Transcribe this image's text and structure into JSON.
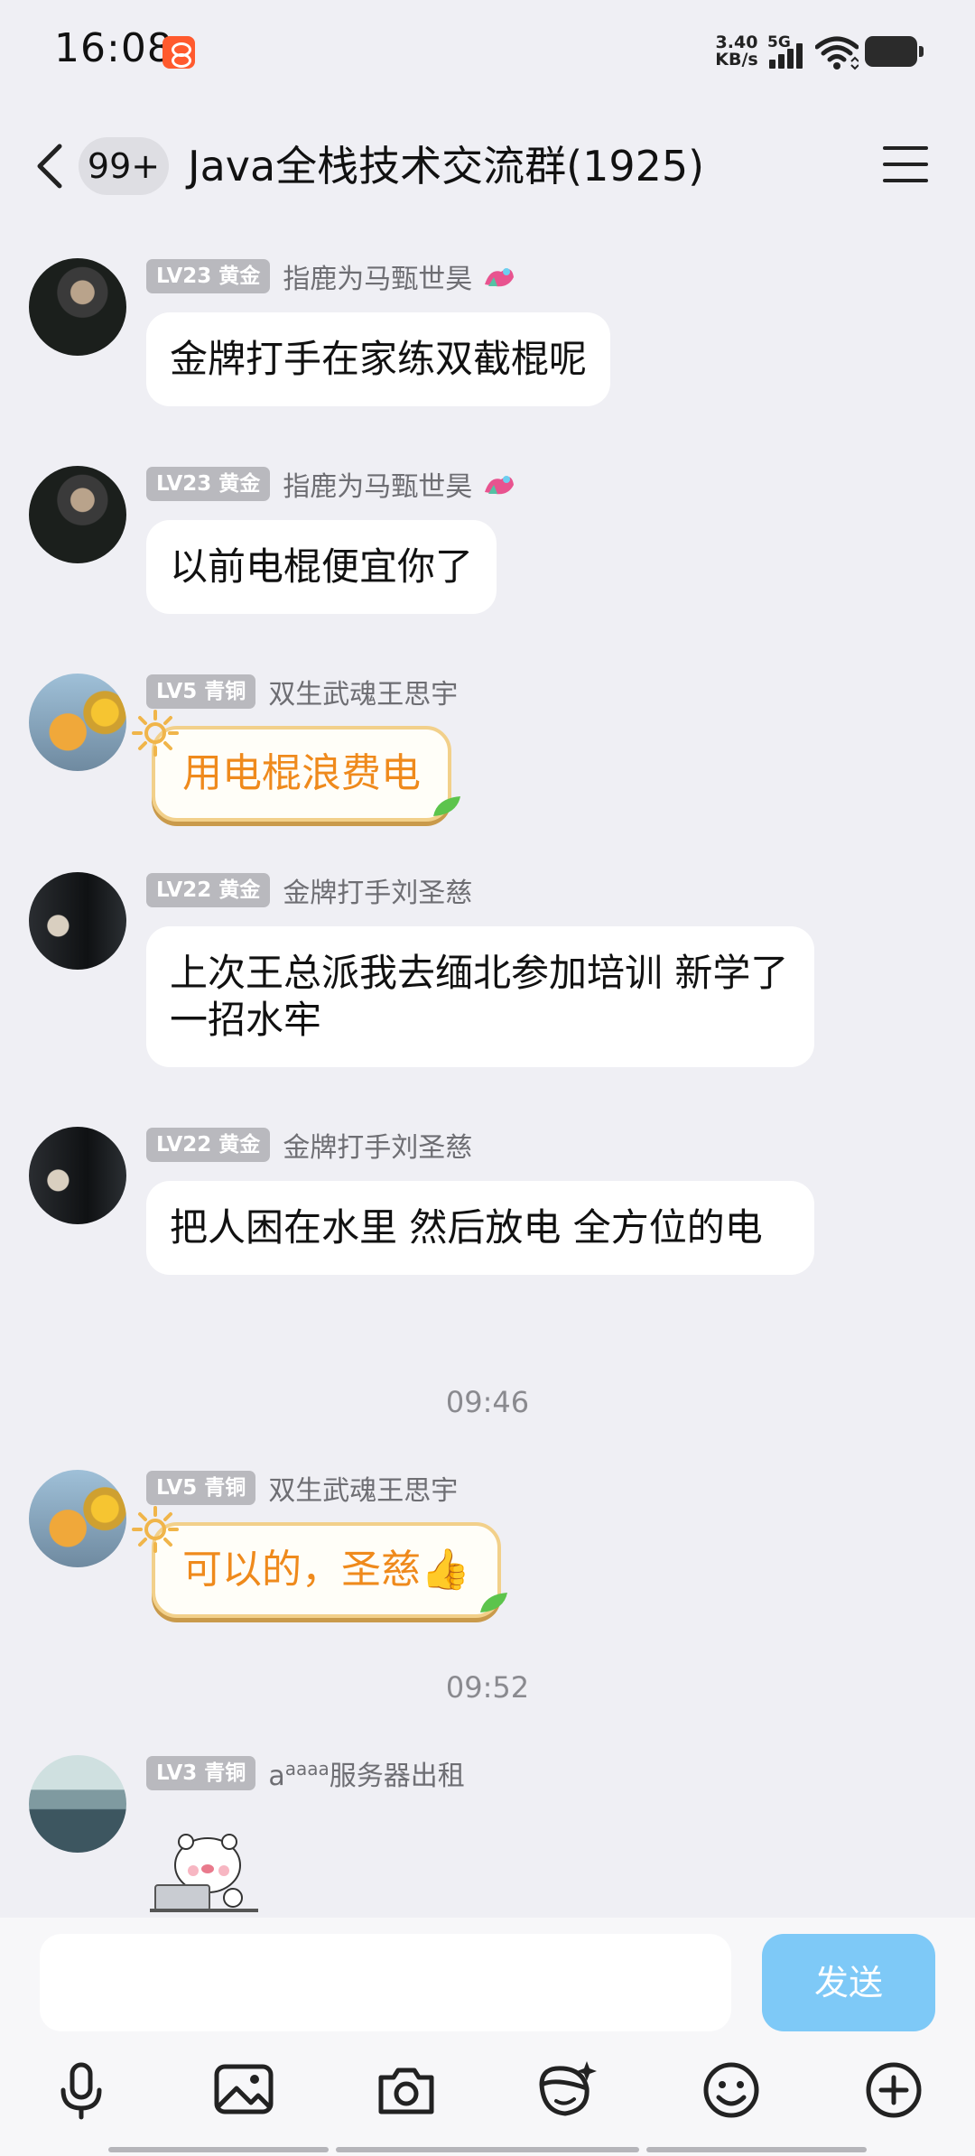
{
  "status_bar": {
    "time": "16:08",
    "net_speed_value": "3.40",
    "net_speed_unit": "KB/s",
    "network_type": "5G",
    "icons": [
      "app-notification-icon",
      "signal-icon",
      "wifi-icon",
      "battery-icon"
    ]
  },
  "header": {
    "unread_count": "99+",
    "title": "Java全栈技术交流群(1925)",
    "icons": [
      "back-icon",
      "menu-icon"
    ]
  },
  "messages": [
    {
      "level": "LV23 黄金",
      "nickname": "指鹿为马甄世昊",
      "text": "金牌打手在家练双截棍呢"
    },
    {
      "level": "LV23 黄金",
      "nickname": "指鹿为马甄世昊",
      "text": "以前电棍便宜你了"
    },
    {
      "level": "LV5 青铜",
      "nickname": "双生武魂王思宇",
      "text": "用电棍浪费电"
    },
    {
      "level": "LV22 黄金",
      "nickname": "金牌打手刘圣慈",
      "text": "上次王总派我去缅北参加培训 新学了一招水牢"
    },
    {
      "level": "LV22 黄金",
      "nickname": "金牌打手刘圣慈",
      "text": "把人困在水里 然后放电 全方位的电"
    },
    {
      "level": "LV5 青铜",
      "nickname": "双生武魂王思宇",
      "text": "可以的，圣慈👍"
    },
    {
      "level": "LV3 青铜",
      "nickname_prefix": "a",
      "nickname_sup": "aaaa",
      "nickname_suffix": "服务器出租",
      "sticker": "bear-laptop-sticker"
    }
  ],
  "timestamps": [
    "09:46",
    "09:52"
  ],
  "input_bar": {
    "send_label": "发送",
    "tools": [
      "microphone-icon",
      "image-icon",
      "camera-icon",
      "emoji-face-icon",
      "smiley-icon",
      "plus-icon"
    ],
    "colors": {
      "send_button": "#7ec9f7"
    }
  },
  "colors": {
    "background": "#efeff4",
    "level_badge": "#b9b9be",
    "fancy_bubble_text": "#ef8a1c"
  }
}
